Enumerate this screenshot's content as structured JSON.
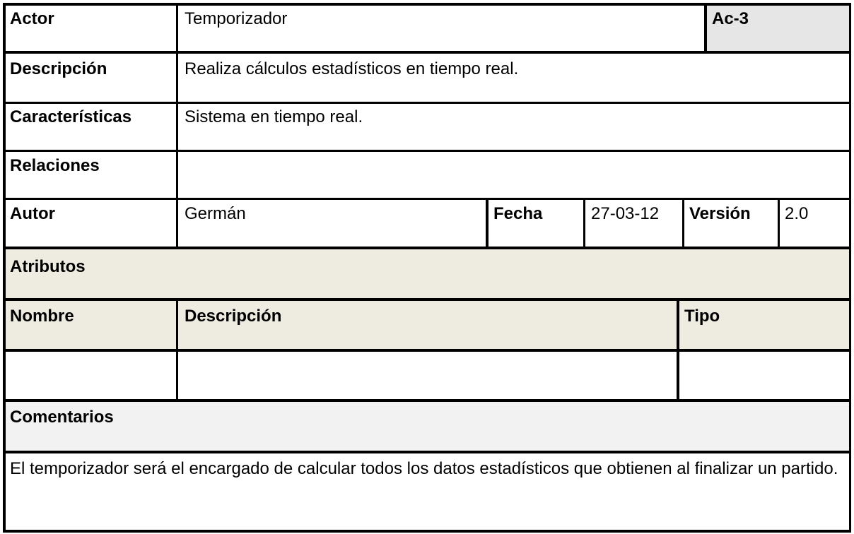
{
  "row1": {
    "actor_label": "Actor",
    "actor_value": "Temporizador",
    "code": "Ac-3"
  },
  "row2": {
    "label": "Descripción",
    "value": "Realiza cálculos estadísticos en tiempo real."
  },
  "row3": {
    "label": "Características",
    "value": "Sistema en tiempo real."
  },
  "row4": {
    "label": "Relaciones",
    "value": ""
  },
  "row5": {
    "autor_label": "Autor",
    "autor_value": "Germán",
    "fecha_label": "Fecha",
    "fecha_value": "27-03-12",
    "version_label": "Versión",
    "version_value": "2.0"
  },
  "atributos": {
    "title": "Atributos",
    "headers": [
      "Nombre",
      "Descripción",
      "Tipo"
    ],
    "rows": [
      [
        "",
        "",
        ""
      ]
    ]
  },
  "comentarios": {
    "title": "Comentarios",
    "text": "El temporizador será el encargado de calcular todos los datos estadísticos que obtienen al finalizar un partido."
  },
  "colors": {
    "code_bg": "#e6e6e6",
    "atributos_bg": "#eeece1",
    "comentarios_bg": "#f2f2f2",
    "border": "#000000"
  }
}
